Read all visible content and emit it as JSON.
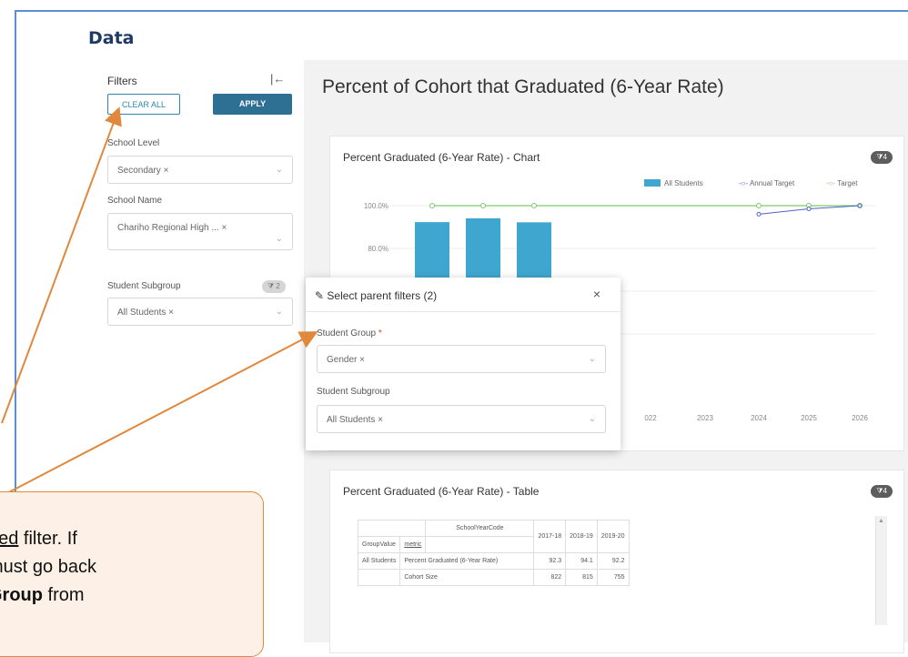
{
  "page": {
    "title": "Data"
  },
  "sidebar": {
    "filters_label": "Filters",
    "collapse_icon": "collapse-left-icon",
    "clear_all": "CLEAR ALL",
    "apply": "APPLY",
    "school_level": {
      "label": "School Level",
      "value": "Secondary ×"
    },
    "school_name": {
      "label": "School Name",
      "value": "Chariho Regional High ...  ×"
    },
    "student_subgroup": {
      "label": "Student Subgroup",
      "value": "All Students ×",
      "badge": "2"
    }
  },
  "main": {
    "title": "Percent of Cohort that Graduated (6-Year Rate)",
    "chart_card": {
      "title": "Percent Graduated (6-Year Rate) - Chart",
      "badge": "4"
    },
    "table_card": {
      "title": "Percent Graduated (6-Year Rate) - Table",
      "badge": "4"
    }
  },
  "chart_data": {
    "type": "bar",
    "title": "Percent Graduated (6-Year Rate) - Chart",
    "y_tick_labels": [
      "100.0%",
      "80.0%"
    ],
    "x_tick_labels": [
      "022",
      "2023",
      "2024",
      "2025",
      "2026"
    ],
    "series": [
      {
        "name": "All Students",
        "kind": "bar",
        "color": "#3fa7cf",
        "x": [
          "2017-18",
          "2018-19",
          "2019-20"
        ],
        "values": [
          92.3,
          94.1,
          92.2
        ]
      },
      {
        "name": "Annual Target",
        "kind": "line",
        "color": "#4f63c9",
        "x": [
          "2024",
          "2025",
          "2026"
        ],
        "values": [
          96.0,
          98.5,
          100.0
        ]
      },
      {
        "name": "Target",
        "kind": "line",
        "color": "#7cc96b",
        "x": [
          "2017-18",
          "2018-19",
          "2019-20",
          "2024",
          "2025",
          "2026"
        ],
        "values": [
          100.0,
          100.0,
          100.0,
          100.0,
          100.0,
          100.0
        ]
      }
    ]
  },
  "modal": {
    "title": "Select parent filters (2)",
    "edit_icon": "pencil-icon",
    "close": "×",
    "student_group": {
      "label": "Student Group",
      "required": "*",
      "value": "Gender ×"
    },
    "student_subgroup": {
      "label": "Student Subgroup",
      "value": "All Students ×"
    }
  },
  "table": {
    "column_header": "SchoolYearCode",
    "row_headers": [
      "GroupValue",
      "metric"
    ],
    "years": [
      "2017-18",
      "2018-19",
      "2019-20"
    ],
    "rows": [
      {
        "group": "All Students",
        "metric": "Percent Graduated (6-Year Rate)",
        "values": [
          "92.3",
          "94.1",
          "92.2"
        ]
      },
      {
        "group": "",
        "metric": "Cohort Size",
        "values": [
          "822",
          "815",
          "755"
        ]
      }
    ]
  },
  "callout": {
    "line1_prefix": "ired",
    "line1_suffix": " filter. If",
    "line2": " must go back",
    "line3_bold": " Group",
    "line3_suffix": " from"
  },
  "colors": {
    "accent": "#2e6f94",
    "annotation": "#e0883b",
    "bar": "#3fa7cf"
  }
}
